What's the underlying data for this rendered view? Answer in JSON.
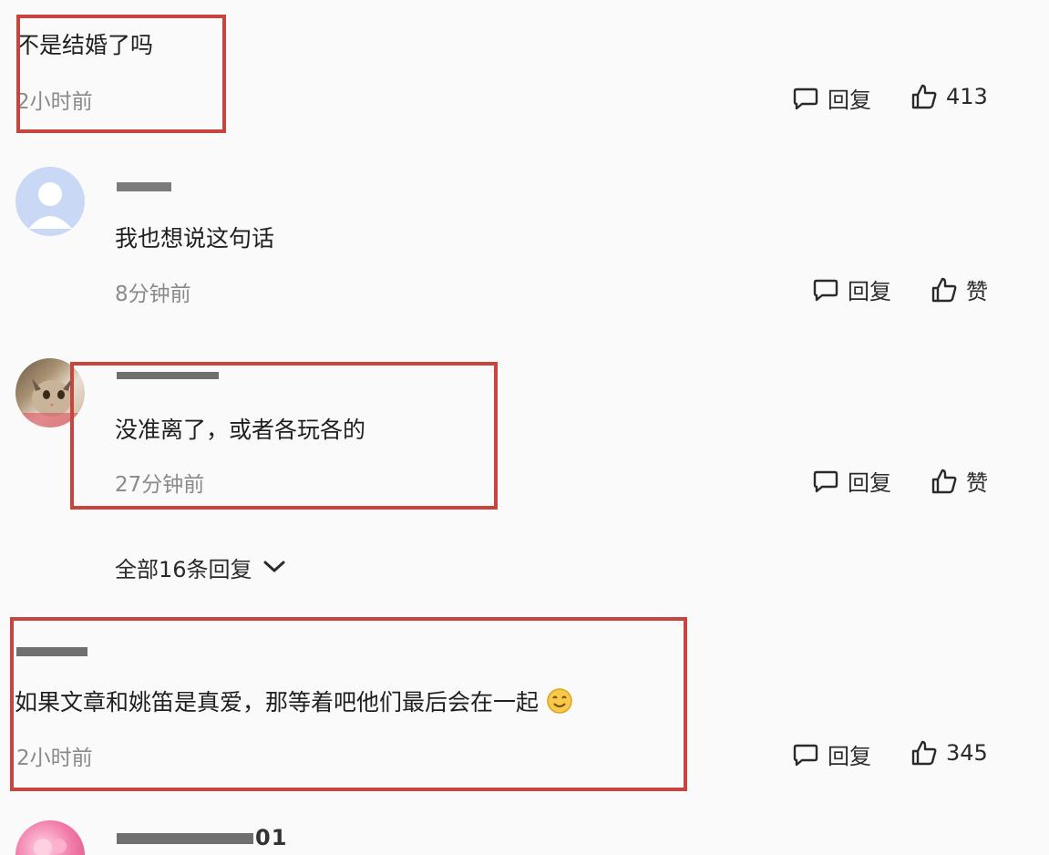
{
  "comments": [
    {
      "text": "不是结婚了吗",
      "time": "2小时前",
      "reply_label": "回复",
      "like_label": "413"
    },
    {
      "username": "",
      "avatar_icon": "default-avatar-icon",
      "text": "我也想说这句话",
      "time": "8分钟前",
      "reply_label": "回复",
      "like_label": "赞"
    },
    {
      "username": "",
      "avatar_icon": "cat-avatar",
      "text": "没准离了，或者各玩各的",
      "time": "27分钟前",
      "reply_label": "回复",
      "like_label": "赞"
    },
    {
      "username": "",
      "text": "如果文章和姚笛是真爱，那等着吧他们最后会在一起",
      "time": "2小时前",
      "reply_label": "回复",
      "like_label": "345",
      "emoji": "smile-emoji"
    },
    {
      "username": "01",
      "avatar_icon": "anime-avatar"
    }
  ],
  "expand_replies_label": "全部16条回复",
  "colors": {
    "highlight_box": "#c8453e",
    "time_text": "#8a8a8a",
    "background": "#fafafa"
  }
}
